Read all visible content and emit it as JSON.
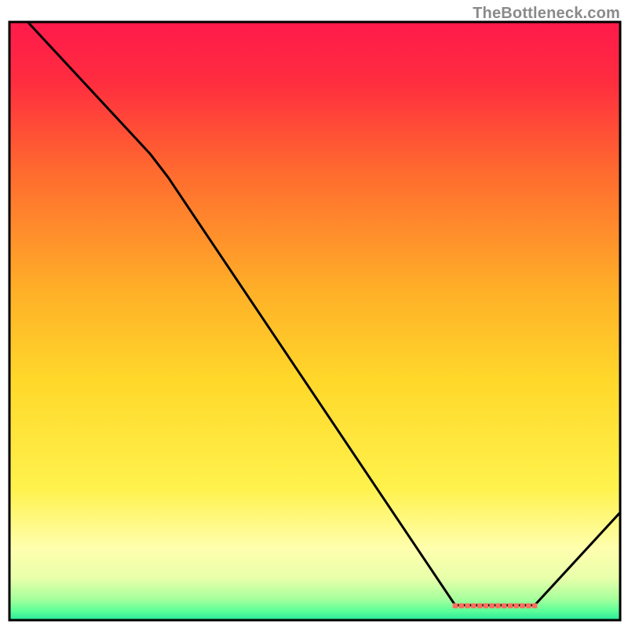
{
  "watermark": "TheBottleneck.com",
  "chart_data": {
    "type": "line",
    "title": "",
    "xlabel": "",
    "ylabel": "",
    "xlim": [
      0,
      100
    ],
    "ylim": [
      0,
      100
    ],
    "grid": false,
    "legend": false,
    "annotations": [],
    "background": {
      "type": "vertical-gradient",
      "stops": [
        {
          "pos": 0.0,
          "color": "#ff1a4b"
        },
        {
          "pos": 0.1,
          "color": "#ff2d3f"
        },
        {
          "pos": 0.25,
          "color": "#ff6a2f"
        },
        {
          "pos": 0.45,
          "color": "#ffb028"
        },
        {
          "pos": 0.6,
          "color": "#ffd82a"
        },
        {
          "pos": 0.78,
          "color": "#fff24d"
        },
        {
          "pos": 0.88,
          "color": "#ffffae"
        },
        {
          "pos": 0.93,
          "color": "#e8ffaa"
        },
        {
          "pos": 0.965,
          "color": "#a5ff9c"
        },
        {
          "pos": 0.985,
          "color": "#5bff99"
        },
        {
          "pos": 1.0,
          "color": "#28e59a"
        }
      ]
    },
    "series": [
      {
        "name": "bottleneck-curve",
        "color": "#000000",
        "points": [
          {
            "x": 3,
            "y": 100
          },
          {
            "x": 23,
            "y": 78
          },
          {
            "x": 26,
            "y": 74
          },
          {
            "x": 73,
            "y": 2.5
          },
          {
            "x": 86,
            "y": 2.5
          },
          {
            "x": 100,
            "y": 18
          }
        ]
      }
    ],
    "marker_strip": {
      "color": "#ff6d5d",
      "y": 2.4,
      "x_start": 73,
      "x_end": 86,
      "count": 14
    }
  }
}
